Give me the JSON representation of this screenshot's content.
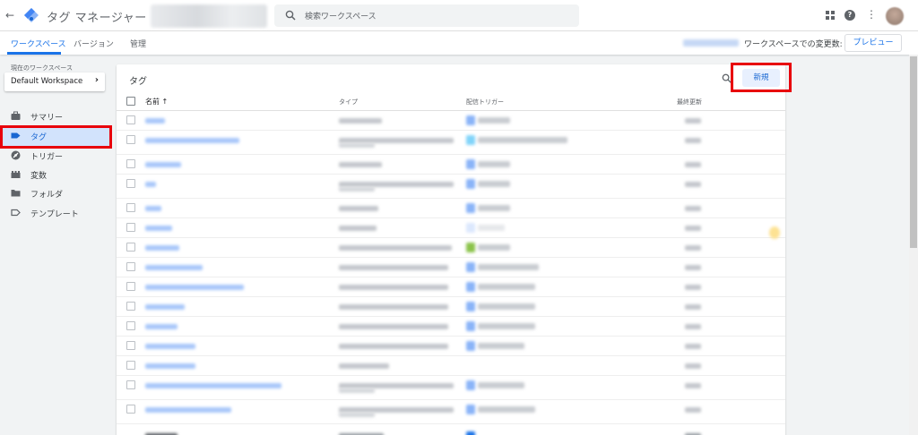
{
  "app": {
    "title": "タグ マネージャー"
  },
  "search": {
    "placeholder": "検索ワークスペース"
  },
  "subnav": {
    "tabs": [
      {
        "label": "ワークスペース",
        "active": true
      },
      {
        "label": "バージョン",
        "active": false
      },
      {
        "label": "管理",
        "active": false
      }
    ],
    "changes_label": "ワークスペースでの変更数: 0",
    "preview_label": "プレビュー"
  },
  "sidebar": {
    "workspace_label": "現在のワークスペース",
    "workspace_name": "Default Workspace",
    "items": [
      {
        "label": "サマリー",
        "icon": "briefcase-icon",
        "active": false
      },
      {
        "label": "タグ",
        "icon": "tag-icon",
        "active": true
      },
      {
        "label": "トリガー",
        "icon": "trigger-icon",
        "active": false
      },
      {
        "label": "変数",
        "icon": "blocks-icon",
        "active": false
      },
      {
        "label": "フォルダ",
        "icon": "folder-icon",
        "active": false
      },
      {
        "label": "テンプレート",
        "icon": "template-icon",
        "active": false
      }
    ]
  },
  "tags_card": {
    "title": "タグ",
    "new_button": "新規",
    "columns": {
      "name": "名前 ↑",
      "type": "タイプ",
      "trigger": "配信トリガー",
      "updated": "最終更新"
    }
  },
  "colors": {
    "accent": "#1a73e8",
    "active_nav_bg": "#d2e3fc",
    "highlight_red": "#e8000b"
  }
}
